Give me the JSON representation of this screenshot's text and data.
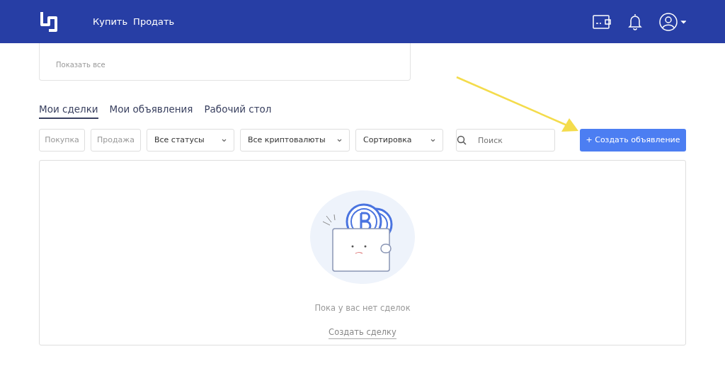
{
  "navbar": {
    "links": [
      "Купить",
      "Продать"
    ]
  },
  "top_card": {
    "link": "Показать все"
  },
  "tabs": [
    {
      "label": "Мои сделки",
      "selected": true
    },
    {
      "label": "Мои объявления",
      "selected": false
    },
    {
      "label": "Рабочий стол",
      "selected": false
    }
  ],
  "filters": {
    "toggles": [
      {
        "label": "Покупка",
        "selected": false
      },
      {
        "label": "Продажа",
        "selected": false
      }
    ],
    "dropdowns": [
      "Все статусы",
      "Все криптовалюты",
      "Сортировка"
    ],
    "search": {
      "placeholder": "Поиск"
    },
    "create_button": "+ Создать объявление"
  },
  "empty_state": {
    "message": "Пока у вас нет сделок",
    "link": "Создать сделку"
  }
}
